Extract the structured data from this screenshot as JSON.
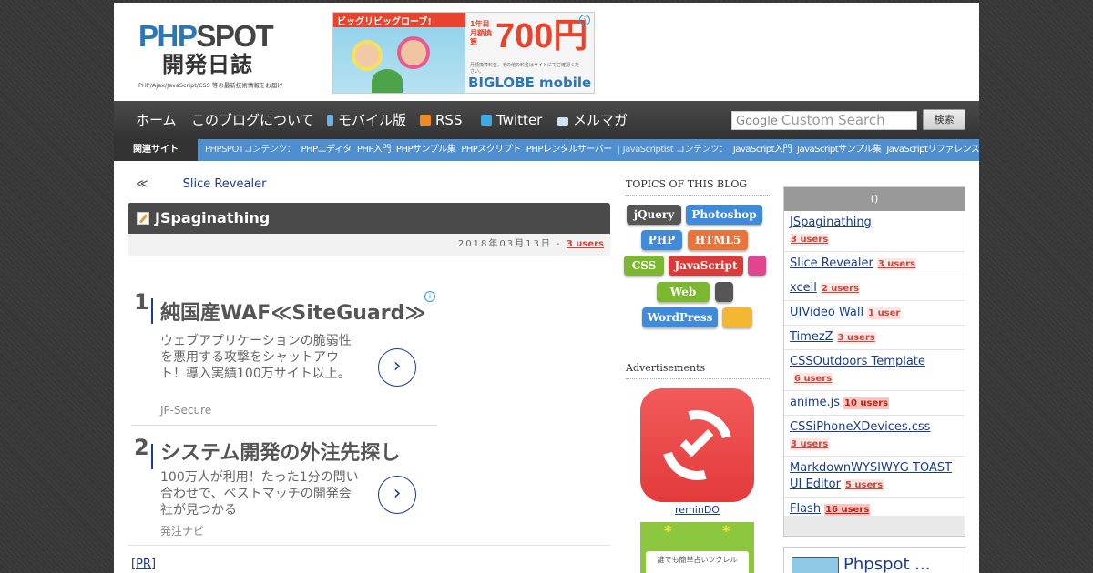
{
  "header": {
    "logo_main_a": "PHP",
    "logo_main_b": "SPOT",
    "logo_sub": "開発日誌",
    "logo_tagline": "PHP/Ajax/JavaScript/CSS 等の最新技術情報をお届け"
  },
  "banner": {
    "strip": "ビッグリビッグローブ!",
    "price_pre": "1年目 月額換算",
    "price": "700円",
    "fine_print": "月額換算料金、その他の料金はサイトにてご確認ください。",
    "brand": "BIGLOBE mobile",
    "info": "i"
  },
  "nav": {
    "items": [
      {
        "label": "ホーム"
      },
      {
        "label": "このブログについて"
      },
      {
        "label": "モバイル版"
      },
      {
        "label": "RSS"
      },
      {
        "label": "Twitter"
      },
      {
        "label": "メルマガ"
      }
    ],
    "search_google": "Google",
    "search_placeholder": "Custom Search",
    "search_button": "検索"
  },
  "related": {
    "label": "関連サイト",
    "php_group": "PHPSPOTコンテンツ：",
    "php_links": [
      "PHPエディタ",
      "PHP入門",
      "PHPサンプル集",
      "PHPスクリプト",
      "PHPレンタルサーバー"
    ],
    "sep": "|",
    "js_group": "JavaScriptist コンテンツ：",
    "js_links": [
      "JavaScript入門",
      "JavaScriptサンプル集",
      "JavaScriptリファレンス"
    ]
  },
  "post": {
    "prev_arrow": "≪",
    "prev_title": "Slice Revealer",
    "title": "JSpaginathing",
    "date": "2018年03月13日",
    "date_sep": "-",
    "users": "3 users"
  },
  "ads": [
    {
      "num": "1",
      "head": "純国産WAF≪SiteGuard≫",
      "body": "ウェブアプリケーションの脆弱性を悪用する攻撃をシャットアウト！導入実績100万サイト以上。",
      "source": "JP-Secure",
      "go": "›"
    },
    {
      "num": "2",
      "head": "システム開発の外注先探し",
      "body": "100万人が利用！たった1分の問い合わせで、ベストマッチの開発会社が見つかる",
      "source": "発注ナビ",
      "go": "›"
    }
  ],
  "ad_info": "i",
  "pr_label": "[PR]",
  "topics": {
    "heading": "TOPICS OF THIS BLOG",
    "tags": [
      {
        "label": "jQuery",
        "color": "#555555"
      },
      {
        "label": "Photoshop",
        "color": "#3f8ad9"
      },
      {
        "label": "PHP",
        "color": "#3f8ad9"
      },
      {
        "label": "HTML5",
        "color": "#e8743b"
      },
      {
        "label": "CSS",
        "color": "#7cb82f"
      },
      {
        "label": "JavaScript",
        "color": "#d93a3a"
      },
      {
        "label": "",
        "color": "#e0468f"
      },
      {
        "label": "Web",
        "color": "#7cb82f"
      },
      {
        "label": "",
        "color": "#555555"
      },
      {
        "label": "WordPress",
        "color": "#3f8ad9"
      },
      {
        "label": "",
        "color": "#f5b731"
      }
    ]
  },
  "sidebar_ads": {
    "heading": "Advertisements",
    "app_name": "reminDO",
    "ad2_card": "誰でも簡単占いツクレル",
    "ad2_star": "*"
  },
  "popular": {
    "heading": "()",
    "items": [
      {
        "title": "JSpaginathing",
        "users": "3 users",
        "hot": false
      },
      {
        "title": "Slice Revealer",
        "users": "3 users",
        "hot": false
      },
      {
        "title": "xcell",
        "users": "2 users",
        "hot": false
      },
      {
        "title": "UIVideo Wall",
        "users": "1 user",
        "hot": false
      },
      {
        "title": "TimezZ",
        "users": "3 users",
        "hot": false
      },
      {
        "title": "CSSOutdoors Template",
        "users": "6 users",
        "hot": false
      },
      {
        "title": "anime.js",
        "users": "10 users",
        "hot": true
      },
      {
        "title": "CSSiPhoneXDevices.css",
        "users": "3 users",
        "hot": false
      },
      {
        "title": "MarkdownWYSIWYG TOAST UI Editor",
        "users": "5 users",
        "hot": false
      },
      {
        "title": "Flash",
        "users": "16 users",
        "hot": true
      }
    ]
  },
  "phpspot_box": {
    "name": "Phpspot ..."
  },
  "colors": {
    "nav_bg": "#3a3a3a",
    "related_bg": "#4f8fd0",
    "link": "#1a3c8f",
    "users": "#d0463a"
  }
}
